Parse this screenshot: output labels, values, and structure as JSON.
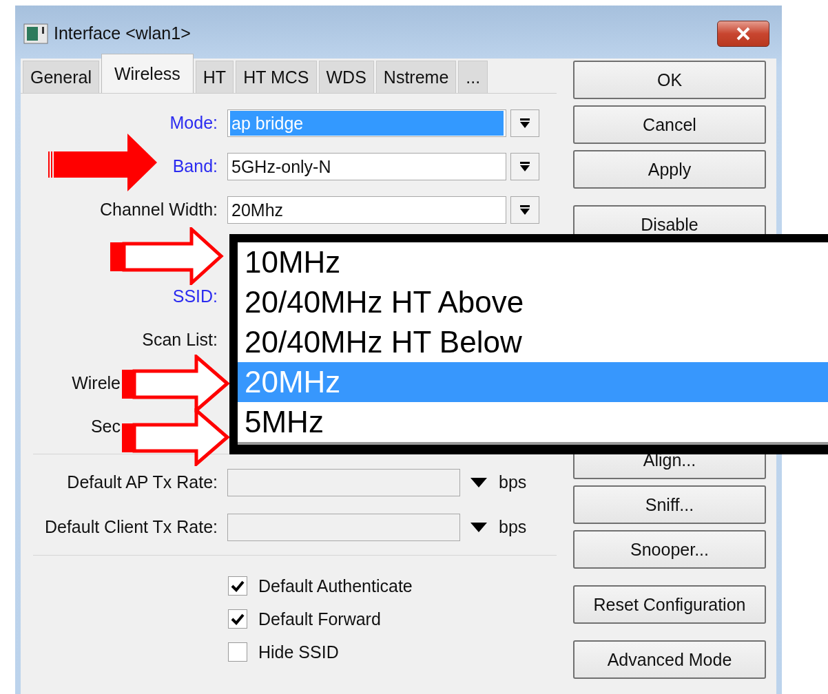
{
  "window": {
    "title": "Interface <wlan1>"
  },
  "tabs": [
    {
      "label": "General",
      "selected": false
    },
    {
      "label": "Wireless",
      "selected": true
    },
    {
      "label": "HT",
      "selected": false
    },
    {
      "label": "HT MCS",
      "selected": false
    },
    {
      "label": "WDS",
      "selected": false
    },
    {
      "label": "Nstreme",
      "selected": false
    },
    {
      "label": "...",
      "selected": false
    }
  ],
  "rows": [
    {
      "kind": "select",
      "label": "Mode:",
      "required": true,
      "value": "ap bridge",
      "highlighted": true
    },
    {
      "kind": "select",
      "label": "Band:",
      "required": true,
      "value": "5GHz-only-N",
      "highlighted": false
    },
    {
      "kind": "select",
      "label": "Channel Width:",
      "required": false,
      "value": "20Mhz",
      "highlighted": false
    },
    {
      "kind": "blank"
    },
    {
      "kind": "covered",
      "label": "SSID:",
      "required": true
    },
    {
      "kind": "covered",
      "label": "Scan List:",
      "required": false
    },
    {
      "kind": "cut",
      "label": "Wirele",
      "required": false
    },
    {
      "kind": "cut",
      "label": "Sec",
      "required": false
    }
  ],
  "rates": [
    {
      "label": "Default AP Tx Rate:",
      "unit": "bps"
    },
    {
      "label": "Default Client Tx Rate:",
      "unit": "bps"
    }
  ],
  "checkboxes": [
    {
      "label": "Default Authenticate",
      "checked": true
    },
    {
      "label": "Default Forward",
      "checked": true
    },
    {
      "label": "Hide SSID",
      "checked": false
    }
  ],
  "button_groups": [
    [
      "OK",
      "Cancel",
      "Apply"
    ],
    [
      "Disable"
    ],
    [
      "Align...",
      "Sniff...",
      "Snooper..."
    ],
    [
      "Reset Configuration"
    ],
    [
      "Advanced Mode"
    ]
  ],
  "dropdown": {
    "options": [
      {
        "label": "10MHz",
        "selected": false
      },
      {
        "label": "20/40MHz HT Above",
        "selected": false
      },
      {
        "label": "20/40MHz HT Below",
        "selected": false
      },
      {
        "label": "20MHz",
        "selected": true
      },
      {
        "label": "5MHz",
        "selected": false
      }
    ]
  }
}
